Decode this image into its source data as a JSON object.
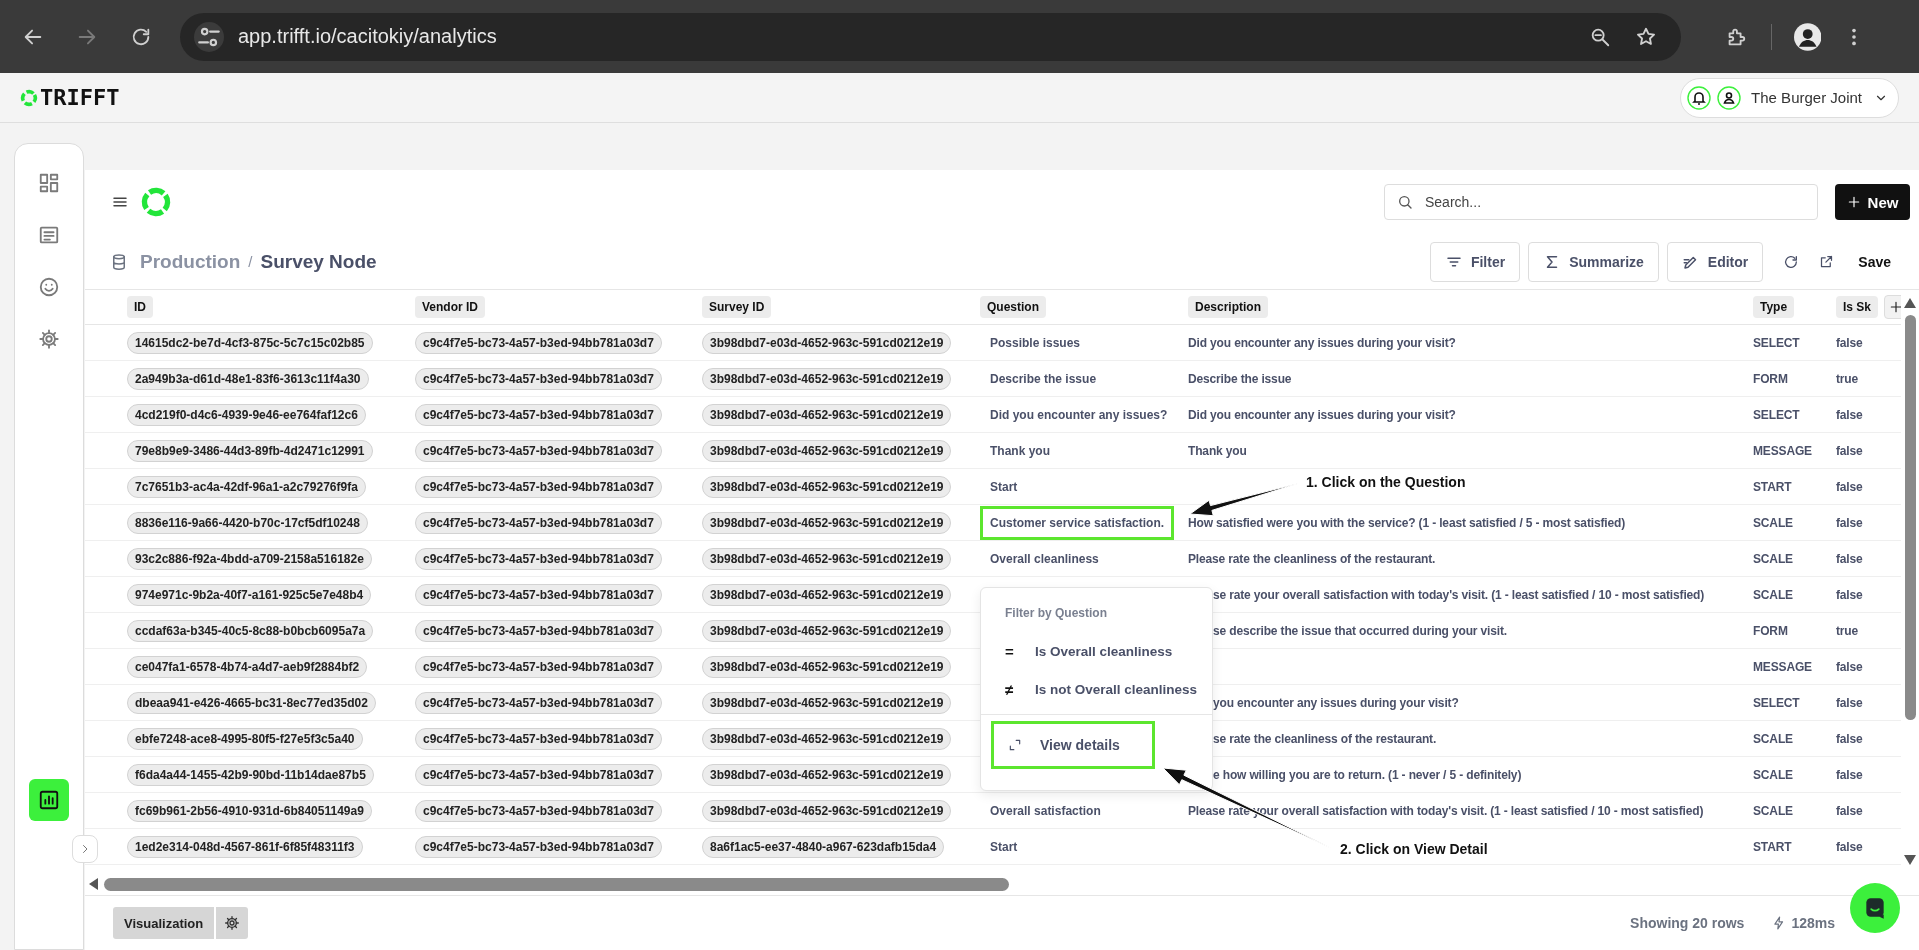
{
  "browser": {
    "url": "app.trifft.io/cacitokiy/analytics",
    "forward_disabled": true
  },
  "app_header": {
    "logo": "TRIFFT",
    "account": "The Burger Joint"
  },
  "sidebar": {
    "items": [
      {
        "kind": "grid",
        "selected": false
      },
      {
        "kind": "document",
        "selected": false
      },
      {
        "kind": "smiley",
        "selected": false
      },
      {
        "kind": "gear",
        "selected": false
      },
      {
        "kind": "chart",
        "selected": true
      }
    ]
  },
  "toolbar": {
    "search_placeholder": "Search...",
    "new_button": "New"
  },
  "breadcrumb": [
    "Production",
    "Survey Node"
  ],
  "breadcrumb_separator": "/",
  "actions": [
    {
      "kind": "filter",
      "label": "Filter"
    },
    {
      "kind": "sigma",
      "label": "Summarize"
    },
    {
      "kind": "editor",
      "label": "Editor"
    }
  ],
  "save_button": "Save",
  "table": {
    "columns": [
      "ID",
      "Vendor ID",
      "Survey ID",
      "Question",
      "Description",
      "Type",
      "Is Sk"
    ],
    "rows": [
      {
        "id": "14615dc2-be7d-4cf3-875c-5c7c15c02b85",
        "vendor_id": "c9c4f7e5-bc73-4a57-b3ed-94bb781a03d7",
        "survey_id": "3b98dbd7-e03d-4652-963c-591cd0212e19",
        "question": "Possible issues",
        "description": "Did you encounter any issues during your visit?",
        "type": "SELECT",
        "column_7": "false"
      },
      {
        "id": "2a949b3a-d61d-48e1-83f6-3613c11f4a30",
        "vendor_id": "c9c4f7e5-bc73-4a57-b3ed-94bb781a03d7",
        "survey_id": "3b98dbd7-e03d-4652-963c-591cd0212e19",
        "question": "Describe the issue",
        "description": "Describe the issue",
        "type": "FORM",
        "column_7": "true"
      },
      {
        "id": "4cd219f0-d4c6-4939-9e46-ee764faf12c6",
        "vendor_id": "c9c4f7e5-bc73-4a57-b3ed-94bb781a03d7",
        "survey_id": "3b98dbd7-e03d-4652-963c-591cd0212e19",
        "question": "Did you encounter any issues?",
        "description": "Did you encounter any issues during your visit?",
        "type": "SELECT",
        "column_7": "false"
      },
      {
        "id": "79e8b9e9-3486-44d3-89fb-4d2471c12991",
        "vendor_id": "c9c4f7e5-bc73-4a57-b3ed-94bb781a03d7",
        "survey_id": "3b98dbd7-e03d-4652-963c-591cd0212e19",
        "question": "Thank you",
        "description": "Thank you",
        "type": "MESSAGE",
        "column_7": "false"
      },
      {
        "id": "7c7651b3-ac4a-42df-96a1-a2c79276f9fa",
        "vendor_id": "c9c4f7e5-bc73-4a57-b3ed-94bb781a03d7",
        "survey_id": "3b98dbd7-e03d-4652-963c-591cd0212e19",
        "question": "Start",
        "type": "START",
        "column_7": "false"
      },
      {
        "id": "8836e116-9a66-4420-b70c-17cf5df10248",
        "vendor_id": "c9c4f7e5-bc73-4a57-b3ed-94bb781a03d7",
        "survey_id": "3b98dbd7-e03d-4652-963c-591cd0212e19",
        "question": "Customer service satisfaction.",
        "description": "How satisfied were you with the service? (1 - least satisfied / 5 - most satisfied)",
        "type": "SCALE",
        "column_7": "false",
        "highlighted": true
      },
      {
        "id": "93c2c886-f92a-4bdd-a709-2158a516182e",
        "vendor_id": "c9c4f7e5-bc73-4a57-b3ed-94bb781a03d7",
        "survey_id": "3b98dbd7-e03d-4652-963c-591cd0212e19",
        "question": "Overall cleanliness",
        "description": "Please rate the cleanliness of the restaurant.",
        "type": "SCALE",
        "column_7": "false"
      },
      {
        "id": "974e971c-9b2a-40f7-a161-925c5e7e48b4",
        "vendor_id": "c9c4f7e5-bc73-4a57-b3ed-94bb781a03d7",
        "survey_id": "3b98dbd7-e03d-4652-963c-591cd0212e19",
        "description": "se rate your overall satisfaction with today's visit. (1 - least satisfied / 10 - most satisfied)",
        "description_cut": true,
        "type": "SCALE",
        "column_7": "false"
      },
      {
        "id": "ccdaf63a-b345-40c5-8c88-b0bcb6095a7a",
        "vendor_id": "c9c4f7e5-bc73-4a57-b3ed-94bb781a03d7",
        "survey_id": "3b98dbd7-e03d-4652-963c-591cd0212e19",
        "description": "se describe the issue that occurred during your visit.",
        "description_cut": true,
        "type": "FORM",
        "column_7": "true"
      },
      {
        "id": "ce047fa1-6578-4b74-a4d7-aeb9f2884bf2",
        "vendor_id": "c9c4f7e5-bc73-4a57-b3ed-94bb781a03d7",
        "survey_id": "3b98dbd7-e03d-4652-963c-591cd0212e19",
        "type": "MESSAGE",
        "column_7": "false"
      },
      {
        "id": "dbeaa941-e426-4665-bc31-8ec77ed35d02",
        "vendor_id": "c9c4f7e5-bc73-4a57-b3ed-94bb781a03d7",
        "survey_id": "3b98dbd7-e03d-4652-963c-591cd0212e19",
        "description": "you encounter any issues during your visit?",
        "description_cut": true,
        "type": "SELECT",
        "column_7": "false"
      },
      {
        "id": "ebfe7248-ace8-4995-80f5-f27e5f3c5a40",
        "vendor_id": "c9c4f7e5-bc73-4a57-b3ed-94bb781a03d7",
        "survey_id": "3b98dbd7-e03d-4652-963c-591cd0212e19",
        "description": "se rate the cleanliness of the restaurant.",
        "description_cut": true,
        "type": "SCALE",
        "column_7": "false"
      },
      {
        "id": "f6da4a44-1455-42b9-90bd-11b14dae87b5",
        "vendor_id": "c9c4f7e5-bc73-4a57-b3ed-94bb781a03d7",
        "survey_id": "3b98dbd7-e03d-4652-963c-591cd0212e19",
        "description": "e how willing you are to return. (1 - never / 5 - definitely)",
        "description_cut": true,
        "type": "SCALE",
        "column_7": "false"
      },
      {
        "id": "fc69b961-2b56-4910-931d-6b84051149a9",
        "vendor_id": "c9c4f7e5-bc73-4a57-b3ed-94bb781a03d7",
        "survey_id": "3b98dbd7-e03d-4652-963c-591cd0212e19",
        "question": "Overall satisfaction",
        "description": "Please rate your overall satisfaction with today's visit. (1 - least satisfied / 10 - most satisfied)",
        "type": "SCALE",
        "column_7": "false"
      },
      {
        "id": "1ed2e314-048d-4567-861f-6f85f48311f3",
        "vendor_id": "c9c4f7e5-bc73-4a57-b3ed-94bb781a03d7",
        "survey_id": "8a6f1ac5-ee37-4840-a967-623dafb15da4",
        "question": "Start",
        "type": "START",
        "column_7": "false"
      }
    ]
  },
  "popup": {
    "title": "Filter by Question",
    "options": [
      {
        "symbol": "=",
        "label": "Is Overall cleanliness"
      },
      {
        "symbol": "≠",
        "label": "Is not Overall cleanliness"
      }
    ],
    "details": {
      "label": "View details",
      "highlighted": true
    }
  },
  "footer": {
    "visualization_button": "Visualization",
    "row_count": "Showing 20 rows",
    "timing": "128ms"
  },
  "annotations": [
    {
      "text": "1. Click on the Question"
    },
    {
      "text": "2. Click on View Detail"
    }
  ]
}
